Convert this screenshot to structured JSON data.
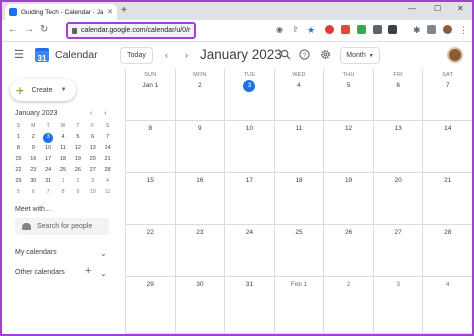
{
  "browser": {
    "tab_title": "Guiding Tech - Calendar - Janu",
    "url": "calendar.google.com/calendar/u/0/r",
    "accent": "#a33fd6"
  },
  "header": {
    "app_title": "Calendar",
    "logo_text": "31",
    "today_label": "Today",
    "month_title": "January 2023",
    "view_label": "Month"
  },
  "sidebar": {
    "create_label": "Create",
    "mini_month_title": "January 2023",
    "mini_days_header": [
      "S",
      "M",
      "T",
      "W",
      "T",
      "F",
      "S"
    ],
    "mini_weeks": [
      [
        "1",
        "2",
        "3",
        "4",
        "5",
        "6",
        "7"
      ],
      [
        "8",
        "9",
        "10",
        "11",
        "12",
        "13",
        "14"
      ],
      [
        "15",
        "16",
        "17",
        "18",
        "19",
        "20",
        "21"
      ],
      [
        "22",
        "23",
        "24",
        "25",
        "26",
        "27",
        "28"
      ],
      [
        "29",
        "30",
        "31",
        "1",
        "2",
        "3",
        "4"
      ],
      [
        "5",
        "6",
        "7",
        "8",
        "9",
        "10",
        "11"
      ]
    ],
    "meet_title": "Meet with...",
    "search_people_placeholder": "Search for people",
    "my_calendars": "My calendars",
    "other_calendars": "Other calendars"
  },
  "month": {
    "dow": [
      "SUN",
      "MON",
      "TUE",
      "WED",
      "THU",
      "FRI",
      "SAT"
    ],
    "weeks": [
      [
        "Jan 1",
        "2",
        "3",
        "4",
        "5",
        "6",
        "7"
      ],
      [
        "8",
        "9",
        "10",
        "11",
        "12",
        "13",
        "14"
      ],
      [
        "15",
        "16",
        "17",
        "18",
        "19",
        "20",
        "21"
      ],
      [
        "22",
        "23",
        "24",
        "25",
        "26",
        "27",
        "28"
      ],
      [
        "29",
        "30",
        "31",
        "Feb 1",
        "2",
        "3",
        "4"
      ]
    ],
    "today_index": [
      0,
      2
    ],
    "today_color": "#1a73e8"
  }
}
